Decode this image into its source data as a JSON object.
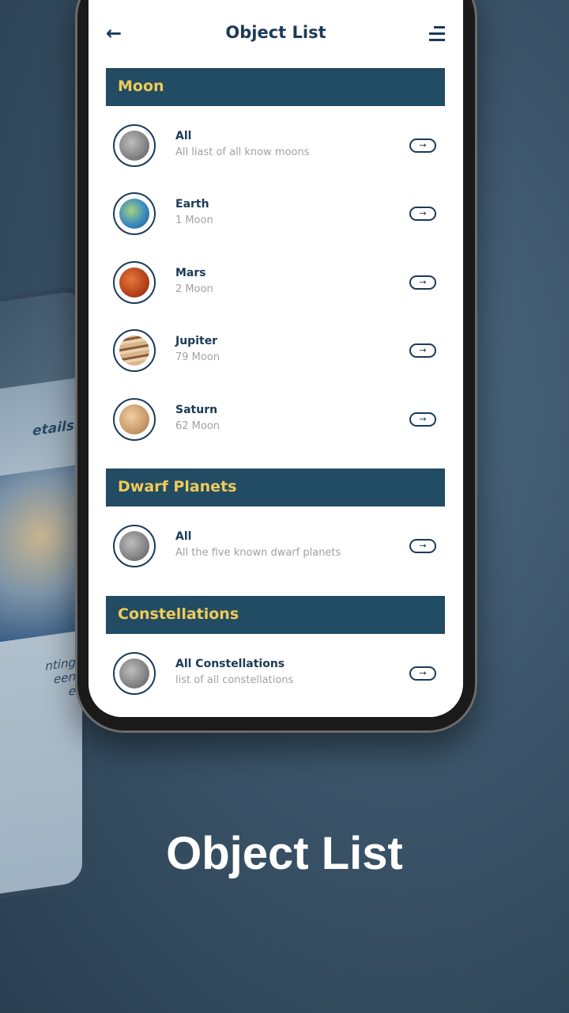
{
  "header": {
    "title": "Object List",
    "back_icon": "arrow-left-icon",
    "menu_icon": "menu-icon"
  },
  "sections": [
    {
      "title": "Moon",
      "items": [
        {
          "name": "All",
          "sub": "All liast of all know moons",
          "icon": "moon-rock"
        },
        {
          "name": "Earth",
          "sub": "1 Moon",
          "icon": "earth"
        },
        {
          "name": "Mars",
          "sub": "2 Moon",
          "icon": "mars"
        },
        {
          "name": "Jupiter",
          "sub": "79 Moon",
          "icon": "jupiter"
        },
        {
          "name": "Saturn",
          "sub": "62 Moon",
          "icon": "saturn"
        }
      ]
    },
    {
      "title": "Dwarf Planets",
      "items": [
        {
          "name": "All",
          "sub": "All the five known dwarf planets",
          "icon": "moon-rock"
        }
      ]
    },
    {
      "title": "Constellations",
      "items": [
        {
          "name": "All Constellations",
          "sub": "list of all constellations",
          "icon": "moon-rock"
        }
      ]
    }
  ],
  "background_phone": {
    "details_fragment": "etails",
    "text_fragment_1": "nting",
    "text_fragment_2": "een",
    "text_fragment_3": "e"
  },
  "caption": "Object List",
  "colors": {
    "section_bar": "#224c64",
    "section_text": "#f0cb56",
    "primary": "#1b3a57",
    "background": "#3b5469"
  }
}
